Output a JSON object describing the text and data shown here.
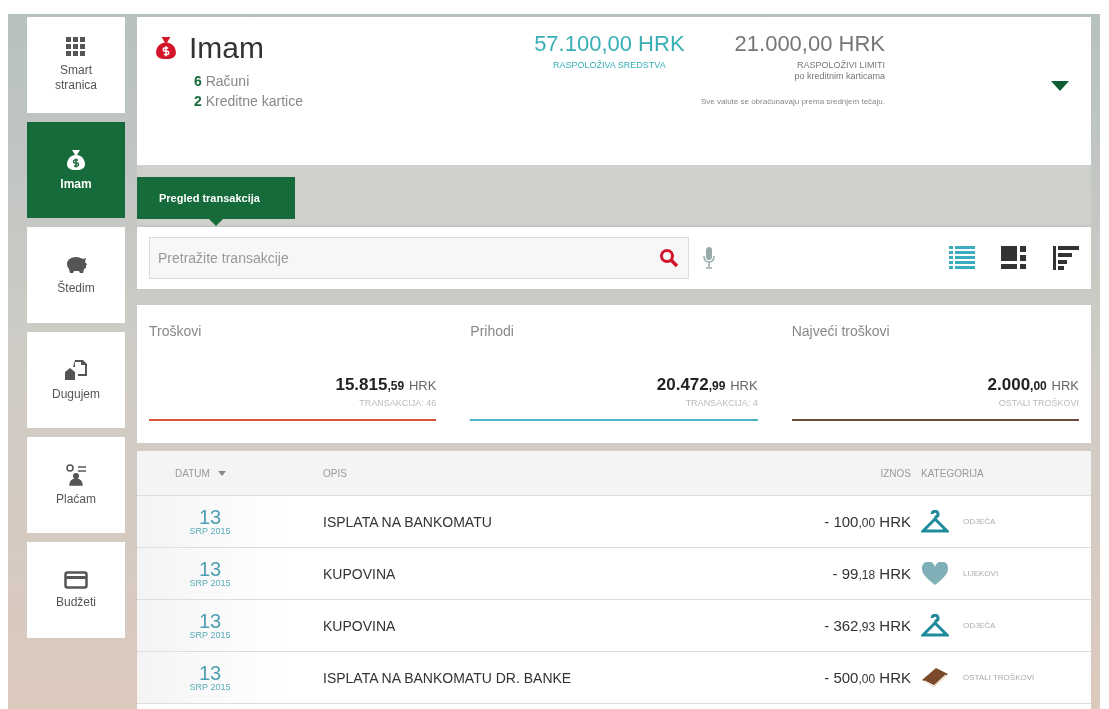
{
  "sidebar": {
    "items": [
      {
        "kind": "grid",
        "label": "Smart stranica",
        "selected": false
      },
      {
        "kind": "moneybag",
        "label": "Imam",
        "selected": true
      },
      {
        "kind": "piggy",
        "label": "Štedim",
        "selected": false
      },
      {
        "kind": "bill",
        "label": "Dugujem",
        "selected": false
      },
      {
        "kind": "transfer",
        "label": "Plaćam",
        "selected": false
      },
      {
        "kind": "card",
        "label": "Budžeti",
        "selected": false
      }
    ]
  },
  "header": {
    "title": "Imam",
    "lines": [
      "**6** Računi",
      "**2** Kreditne kartice"
    ],
    "balances": [
      {
        "amount": "57.100,00 HRK",
        "label": "RASPOLOŽIVA SREDSTVA",
        "kind": "primary"
      },
      {
        "amount": "21.000,00 HRK",
        "label": "RASPOLOŽIVI LIMITI",
        "sublabel": "po kreditnim karticama",
        "kind": "secondary"
      }
    ],
    "note": "Sve valute se obračunavaju prema srednjem tečaju."
  },
  "tabs": [
    {
      "label": "Pregled transakcija",
      "selected": true
    }
  ],
  "search": {
    "placeholder": "Pretražite transakcije"
  },
  "views": [
    {
      "kind": "list",
      "selected": true
    },
    {
      "kind": "tiles",
      "selected": false
    },
    {
      "kind": "bars",
      "selected": false
    }
  ],
  "summary": [
    {
      "title": "Troškovi",
      "whole": "15.815",
      "decimals": ",59",
      "currency": "HRK",
      "caption": "TRANSAKCIJA: 46",
      "color": "#d9533b"
    },
    {
      "title": "Prihodi",
      "whole": "20.472",
      "decimals": ",99",
      "currency": "HRK",
      "caption": "TRANSAKCIJA: 4",
      "color": "#4fb3c4"
    },
    {
      "title": "Najveći troškovi",
      "whole": "2.000",
      "decimals": ",00",
      "currency": "HRK",
      "caption": "OSTALI TROŠKOVI",
      "color": "#6b4a3a"
    }
  ],
  "table": {
    "columns": [
      "DATUM",
      "OPIS",
      "IZNOS",
      "KATEGORIJA"
    ],
    "rows": [
      {
        "day": "13",
        "month": "SRP 2015",
        "description": "ISPLATA NA BANKOMATU",
        "whole": "- 100",
        "decimals": ",00",
        "currency": "HRK",
        "category": "ODJEĆA",
        "kind": "hanger"
      },
      {
        "day": "13",
        "month": "SRP 2015",
        "description": "KUPOVINA",
        "whole": "- 99",
        "decimals": ",18",
        "currency": "HRK",
        "category": "LIJEKOVI",
        "kind": "heart"
      },
      {
        "day": "13",
        "month": "SRP 2015",
        "description": "KUPOVINA",
        "whole": "- 362",
        "decimals": ",93",
        "currency": "HRK",
        "category": "ODJEĆA",
        "kind": "hanger"
      },
      {
        "day": "13",
        "month": "SRP 2015",
        "description": "ISPLATA NA BANKOMATU DR. BANKE",
        "whole": "- 500",
        "decimals": ",00",
        "currency": "HRK",
        "category": "OSTALI TROŠKOVI",
        "kind": "book"
      }
    ]
  }
}
